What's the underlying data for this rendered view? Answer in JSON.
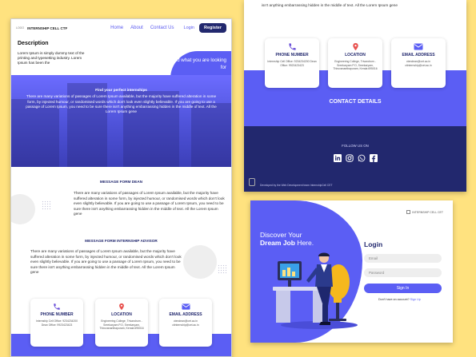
{
  "colors": {
    "accent": "#5b5ef4",
    "dark": "#22286e",
    "background": "#ffe27f"
  },
  "site": {
    "logo": "LOGO",
    "brand": "INTERNSHIP CELL CTF",
    "nav": [
      "Home",
      "About",
      "Contact Us"
    ],
    "login": "Login",
    "register": "Register"
  },
  "description": {
    "title": "Description",
    "text": "Lorem Ipsum is simply dummy text of the printing and typesetting industry. Lorem Ipsum has been the"
  },
  "find_blob": "Find what you are looking for",
  "hero": {
    "heading": "Find your perfect internships",
    "text": "There are many variations of passages of Lorem Ipsum available, but the majority have suffered alteration in some form, by injected humour, or randomised words which don't look even slightly believable. If you are going to use a passage of Lorem Ipsum, you need to be sure there isn't anything embarrassing hidden in the middle of text. All the Lorem Ipsum gene"
  },
  "message_dean": {
    "title": "MESSAGE FORM DEAN",
    "text": "There are many variations of passages of Lorem Ipsum available, but the majority have suffered alteration in some form, by injected humour, or randomised words which don't look even slightly believable. If you are going to use a passage of Lorem Ipsum, you need to be sure there isn't anything embarrassing hidden in the middle of text. All the Lorem Ipsum gene"
  },
  "message_advisor": {
    "title": "MESSAGE FORM INTERNSHIP ADVISOR",
    "text": "There are many variations of passages of Lorem Ipsum available, but the majority have suffered alteration in some form, by injected humour, or randomised words which don't look even slightly believable. If you are going to use a passage of Lorem Ipsum, you need to be sure there isn't anything embarrassing hidden in the middle of text. All the Lorem Ipsum gene"
  },
  "contacts": [
    {
      "title": "PHONE NUMBER",
      "value": "Internship Cell Office: 9234234200 Dean Office: 9923423423",
      "icon": "phone-icon"
    },
    {
      "title": "LOCATION",
      "value": "Engineering College, Trivandrum - Sreekaryam P.O, Sreekaryam, Thiruvananthapuram, Kerala 695016",
      "icon": "location-icon"
    },
    {
      "title": "EMAIL ADDRESS",
      "value": "ctendean@cet.ac.in ctinternship@cet.ac.in",
      "icon": "mail-icon"
    }
  ],
  "footer": {
    "top_text": "isn't anything embarrassing hidden in the middle of text. All the Lorem Ipsum gene",
    "contact_details": "CONTACT DETAILS",
    "follow_us": "FOLLOW US ON",
    "socials": [
      "linkedin-icon",
      "instagram-icon",
      "whatsapp-icon",
      "facebook-icon"
    ],
    "developed_by": "Developed by the Web Development team InternshipCell CET"
  },
  "login_page": {
    "logo_text": "INTERNSHIP CELL CET",
    "headline_line1": "Discover Your",
    "headline_bold": "Dream Job",
    "headline_rest": " Here.",
    "title": "Login",
    "email_placeholder": "Email",
    "password_placeholder": "Password",
    "signin": "Sign In",
    "no_account": "Don't have an account?",
    "signup": "Sign Up"
  }
}
